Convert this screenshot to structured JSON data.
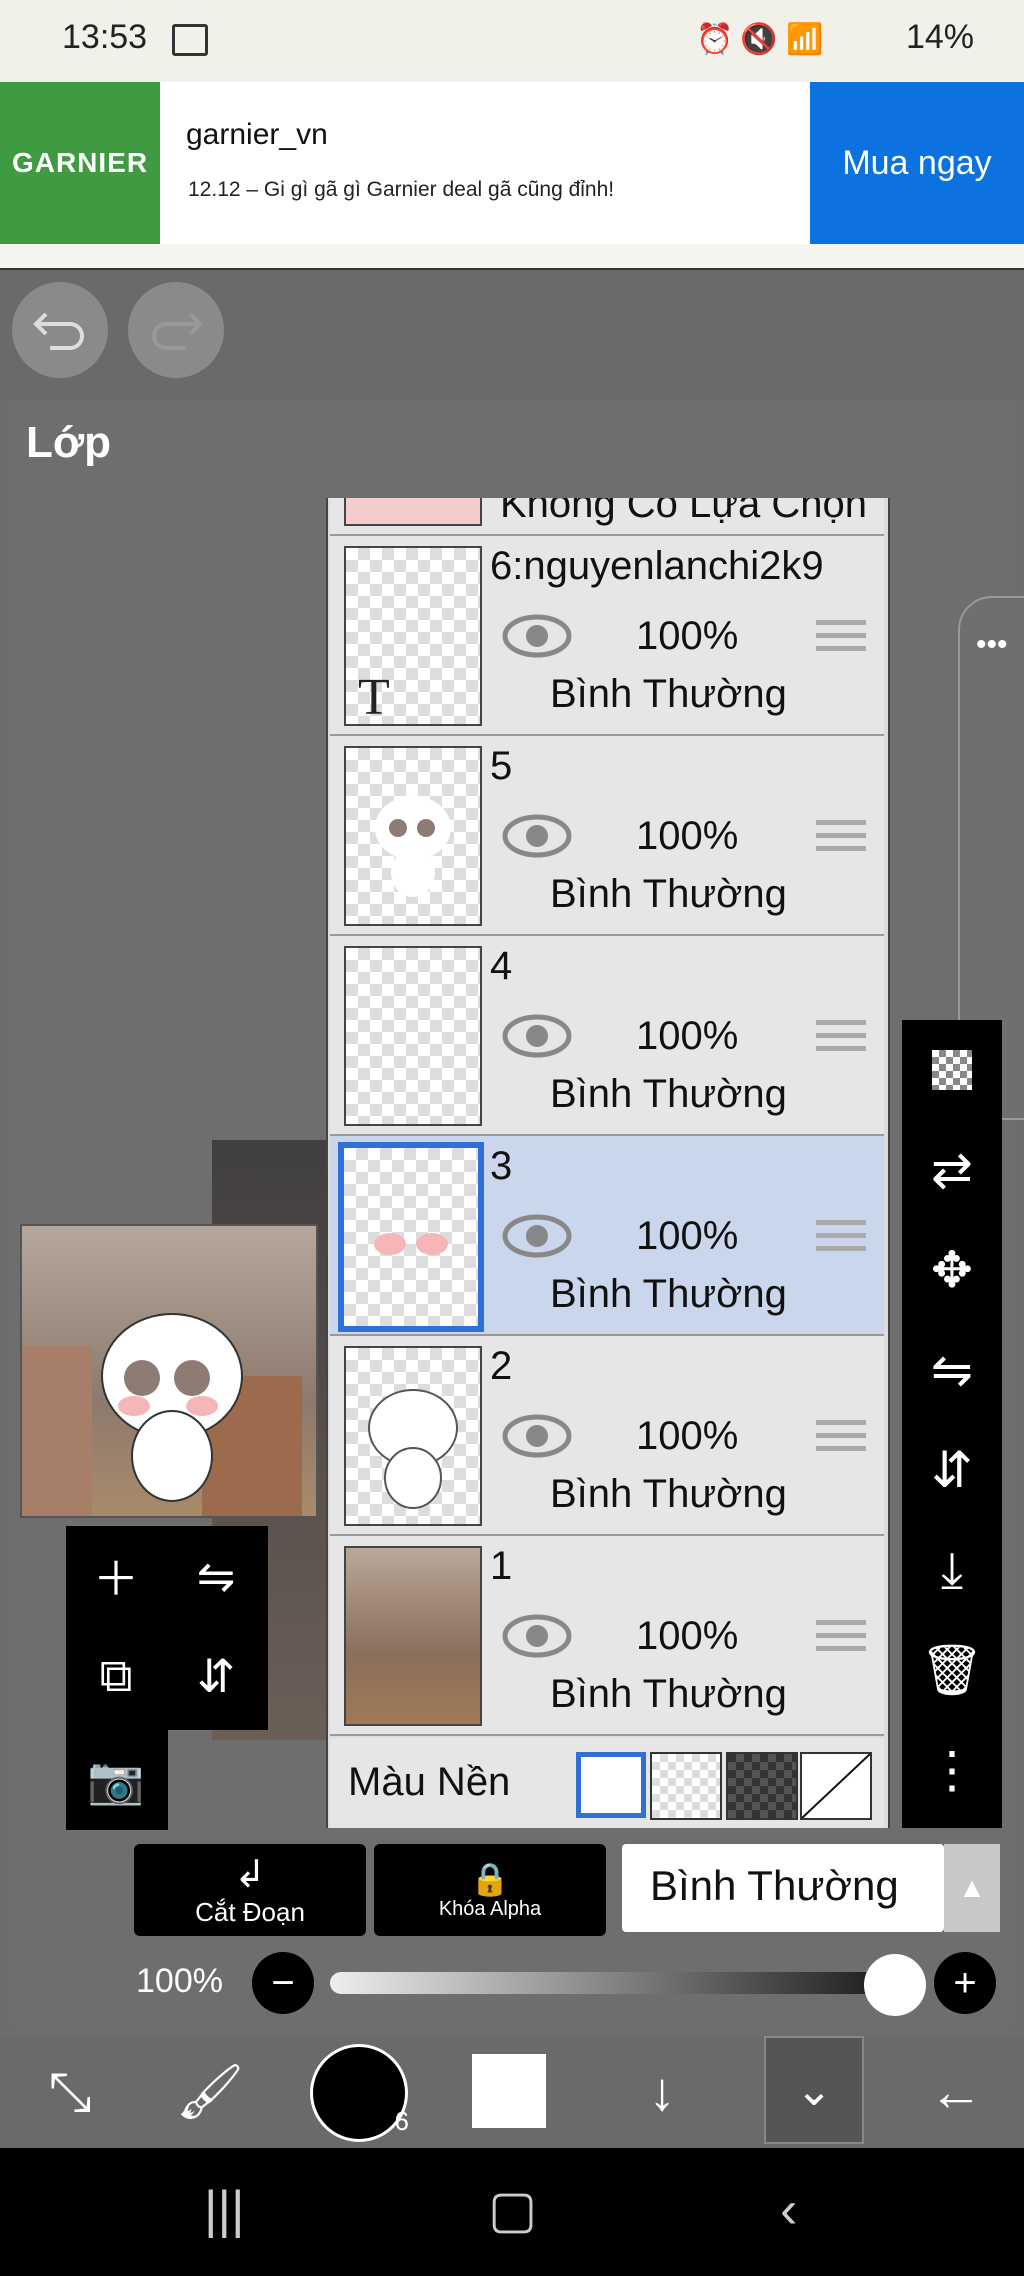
{
  "status_bar": {
    "time": "13:53",
    "battery": "14%"
  },
  "ad": {
    "logo": "GARNIER",
    "account": "garnier_vn",
    "text": "12.12 – Gi gì gã gì Garnier deal gã cũng đỉnh!",
    "cta": "Mua ngay"
  },
  "panel": {
    "title": "Lớp"
  },
  "layers": [
    {
      "name": "6:nguyenlanchi2k9",
      "opacity": "100%",
      "blend": "Bình Thường"
    },
    {
      "name": "5",
      "opacity": "100%",
      "blend": "Bình Thường"
    },
    {
      "name": "4",
      "opacity": "100%",
      "blend": "Bình Thường"
    },
    {
      "name": "3",
      "opacity": "100%",
      "blend": "Bình Thường",
      "selected": true
    },
    {
      "name": "2",
      "opacity": "100%",
      "blend": "Bình Thường"
    },
    {
      "name": "1",
      "opacity": "100%",
      "blend": "Bình Thường"
    }
  ],
  "clipped_top_label": "Không Có Lựa Chọn",
  "background": {
    "label": "Màu Nền"
  },
  "bottom_controls": {
    "clip_label": "Cắt Đoạn",
    "alpha_lock_label": "Khóa Alpha",
    "blend_mode": "Bình Thường",
    "opacity_label": "100%",
    "opacity_value": 1.0
  },
  "brush_size_badge": "6",
  "colors": {
    "selected_layer": "#c9d6ec",
    "selection_border": "#2f6fd6",
    "ad_cta": "#0b72e0",
    "ad_logo": "#3f9a42"
  }
}
